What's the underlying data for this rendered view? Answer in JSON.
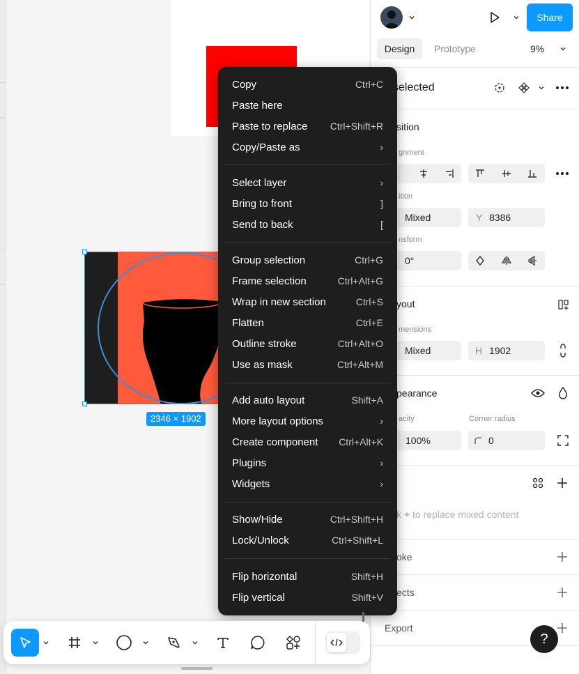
{
  "canvas": {
    "selection_dimensions": "2346 × 1902"
  },
  "header": {
    "share_label": "Share",
    "tabs": [
      {
        "label": "Design"
      },
      {
        "label": "Prototype"
      }
    ],
    "zoom": "9%"
  },
  "panel": {
    "selection_title": "selected",
    "position": {
      "title": "sition",
      "alignment_label": "gnment",
      "position_label": "ition",
      "x_value": "Mixed",
      "y_prefix": "Y",
      "y_value": "8386",
      "transform_label": "nsform",
      "rotation_value": "0°"
    },
    "layout": {
      "title": "yout",
      "dimensions_label": "mensions",
      "w_value": "Mixed",
      "h_prefix": "H",
      "h_value": "1902"
    },
    "appearance": {
      "title": "pearance",
      "opacity_label": "acity",
      "opacity_value": "100%",
      "corner_radius_label": "Corner radius",
      "corner_radius_value": "0"
    },
    "fill": {
      "hint_prefix": "ck",
      "hint_plus": "+",
      "hint_suffix": "to replace mixed content"
    },
    "stroke_title": "oke",
    "effects_title": "ects",
    "export_title": "Export"
  },
  "context_menu": {
    "items": [
      {
        "label": "Copy",
        "shortcut": "Ctrl+C"
      },
      {
        "label": "Paste here",
        "shortcut": ""
      },
      {
        "label": "Paste to replace",
        "shortcut": "Ctrl+Shift+R"
      },
      {
        "label": "Copy/Paste as",
        "shortcut": "›"
      },
      {
        "label": "Select layer",
        "shortcut": "›"
      },
      {
        "label": "Bring to front",
        "shortcut": "]"
      },
      {
        "label": "Send to back",
        "shortcut": "["
      },
      {
        "label": "Group selection",
        "shortcut": "Ctrl+G"
      },
      {
        "label": "Frame selection",
        "shortcut": "Ctrl+Alt+G"
      },
      {
        "label": "Wrap in new section",
        "shortcut": "Ctrl+S"
      },
      {
        "label": "Flatten",
        "shortcut": "Ctrl+E"
      },
      {
        "label": "Outline stroke",
        "shortcut": "Ctrl+Alt+O"
      },
      {
        "label": "Use as mask",
        "shortcut": "Ctrl+Alt+M"
      },
      {
        "label": "Add auto layout",
        "shortcut": "Shift+A"
      },
      {
        "label": "More layout options",
        "shortcut": "›"
      },
      {
        "label": "Create component",
        "shortcut": "Ctrl+Alt+K"
      },
      {
        "label": "Plugins",
        "shortcut": "›"
      },
      {
        "label": "Widgets",
        "shortcut": "›"
      },
      {
        "label": "Show/Hide",
        "shortcut": "Ctrl+Shift+H"
      },
      {
        "label": "Lock/Unlock",
        "shortcut": "Ctrl+Shift+L"
      },
      {
        "label": "Flip horizontal",
        "shortcut": "Shift+H"
      },
      {
        "label": "Flip vertical",
        "shortcut": "Shift+V"
      }
    ]
  },
  "help_label": "?",
  "colors": {
    "accent": "#0d99ff",
    "menu_bg": "#1e1e1e",
    "red_square": "#ff0000",
    "image_orange": "#ff5a3c"
  },
  "icons": [
    "avatar",
    "play-icon",
    "chevron-down-icon",
    "more-icon",
    "move-tool-icon",
    "frame-tool-icon",
    "ellipse-tool-icon",
    "pen-tool-icon",
    "text-tool-icon",
    "comment-tool-icon",
    "actions-tool-icon",
    "dev-mode-icon",
    "eye-icon",
    "drop-icon",
    "plus-icon"
  ]
}
